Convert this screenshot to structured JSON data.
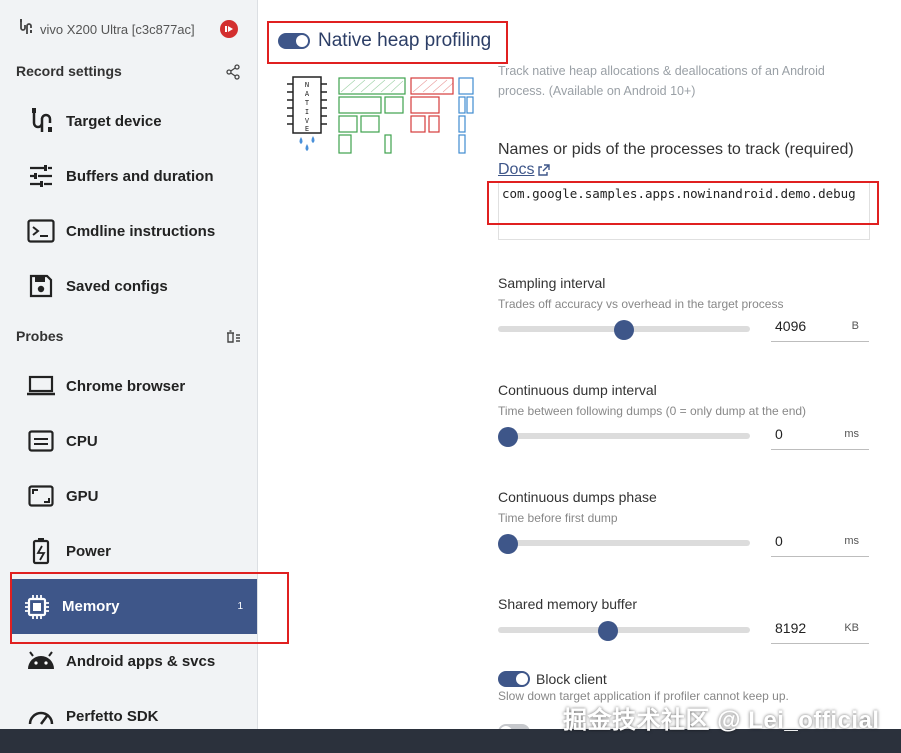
{
  "sidebar": {
    "device": "vivo X200 Ultra [c3c877ac]",
    "record_settings": "Record settings",
    "probes": "Probes",
    "record_items": [
      {
        "label": "Target device",
        "icon": "usb-plug-icon"
      },
      {
        "label": "Buffers and duration",
        "icon": "tune-sliders-icon"
      },
      {
        "label": "Cmdline instructions",
        "icon": "terminal-icon"
      },
      {
        "label": "Saved configs",
        "icon": "save-icon"
      }
    ],
    "probe_items": [
      {
        "label": "Chrome browser",
        "icon": "laptop-icon"
      },
      {
        "label": "CPU",
        "icon": "cpu-card-icon"
      },
      {
        "label": "GPU",
        "icon": "gpu-icon"
      },
      {
        "label": "Power",
        "icon": "battery-icon"
      },
      {
        "label": "Memory",
        "icon": "memory-chip-icon",
        "badge": "1",
        "active": true
      },
      {
        "label": "Android apps & svcs",
        "icon": "android-icon"
      },
      {
        "label": "Perfetto SDK",
        "icon": "gauge-icon"
      }
    ]
  },
  "probe": {
    "title": "Native heap profiling",
    "enabled": true,
    "description": "Track native heap allocations & deallocations of an Android process. (Available on Android 10+)"
  },
  "processes": {
    "label": "Names or pids of the processes to track (required)",
    "docs": "Docs",
    "value": "com.google.samples.apps.nowinandroid.demo.debug"
  },
  "settings": [
    {
      "title": "Sampling interval",
      "subtitle": "Trades off accuracy vs overhead in the target process",
      "value": "4096",
      "unit": "B",
      "slider_fraction": 0.5
    },
    {
      "title": "Continuous dump interval",
      "subtitle": "Time between following dumps (0 = only dump at the end)",
      "value": "0",
      "unit": "ms",
      "slider_fraction": 0.0
    },
    {
      "title": "Continuous dumps phase",
      "subtitle": "Time before first dump",
      "value": "0",
      "unit": "ms",
      "slider_fraction": 0.0
    },
    {
      "title": "Shared memory buffer",
      "subtitle": "",
      "value": "8192",
      "unit": "KB",
      "slider_fraction": 0.43
    }
  ],
  "block_client": {
    "label": "Block client",
    "enabled": true,
    "description": "Slow down target application if profiler cannot keep up."
  },
  "watermark": "掘金技术社区 @ Lei_official",
  "colors": {
    "accent": "#3e5689",
    "highlight_box": "#e02020",
    "stop_red": "#d32f2f"
  }
}
